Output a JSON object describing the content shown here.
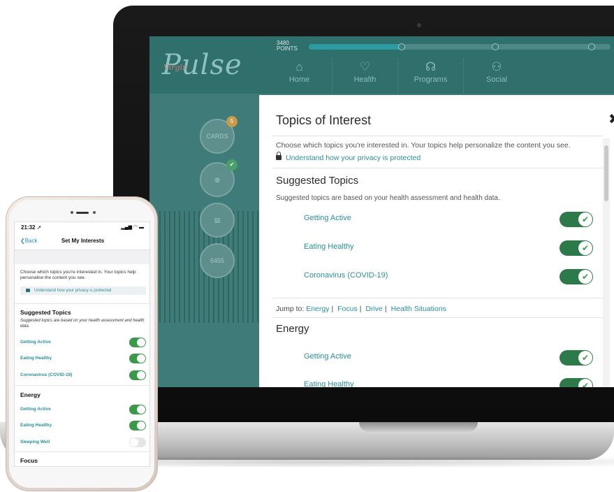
{
  "laptop": {
    "header": {
      "logo_main": "Pulse",
      "logo_small": "Virgin",
      "points_value": "3480",
      "points_label": "POINTS",
      "progress_fraction": 0.31,
      "nav": [
        {
          "label": "Home",
          "icon": "house-icon"
        },
        {
          "label": "Health",
          "icon": "heart-icon"
        },
        {
          "label": "Programs",
          "icon": "programs-icon"
        },
        {
          "label": "Social",
          "icon": "people-icon"
        }
      ]
    },
    "sidebar": {
      "cards_label": "CARDS",
      "cards_badge": "5",
      "steps_value": "6455"
    },
    "modal": {
      "title": "Topics of Interest",
      "close_glyph": "✖",
      "intro": "Choose which topics you're interested in. Your topics help personalize the content you see.",
      "privacy_link": "Understand how your privacy is protected",
      "suggested_heading": "Suggested Topics",
      "suggested_sub": "Suggested topics are based on your health assessment and health data.",
      "suggested_items": [
        {
          "label": "Getting Active",
          "enabled": true
        },
        {
          "label": "Eating Healthy",
          "enabled": true
        },
        {
          "label": "Coronavirus (COVID-19)",
          "enabled": true
        }
      ],
      "jump_label": "Jump to:",
      "jump_links": [
        "Energy",
        "Focus",
        "Drive",
        "Health Situations"
      ],
      "energy_heading": "Energy",
      "energy_items": [
        {
          "label": "Getting Active",
          "enabled": true
        },
        {
          "label": "Eating Healthy",
          "enabled": true
        }
      ],
      "check_glyph": "✔"
    }
  },
  "phone": {
    "status_time": "21:32 ➚",
    "status_icons": "▂▄▆ ◠ ▬",
    "back_label": "Back",
    "back_glyph": "❮",
    "title": "Set My Interests",
    "intro": "Choose which topics you're interested in. Your topics help personalise the content you see.",
    "privacy_link": "Understand how your privacy is protected",
    "suggested_heading": "Suggested Topics",
    "suggested_sub": "Suggested topics are based on your health assessment and health data.",
    "suggested_items": [
      {
        "label": "Getting Active",
        "enabled": true
      },
      {
        "label": "Eating Healthy",
        "enabled": true
      },
      {
        "label": "Coronavirus (COVID-19)",
        "enabled": true
      }
    ],
    "energy_heading": "Energy",
    "energy_items": [
      {
        "label": "Getting Active",
        "enabled": true
      },
      {
        "label": "Eating Healthy",
        "enabled": true
      },
      {
        "label": "Sleeping Well",
        "enabled": false
      }
    ],
    "focus_heading": "Focus"
  },
  "colors": {
    "accent_teal": "#2a8f97",
    "toggle_green": "#2c7a4a",
    "app_teal": "#2f6f6c"
  }
}
